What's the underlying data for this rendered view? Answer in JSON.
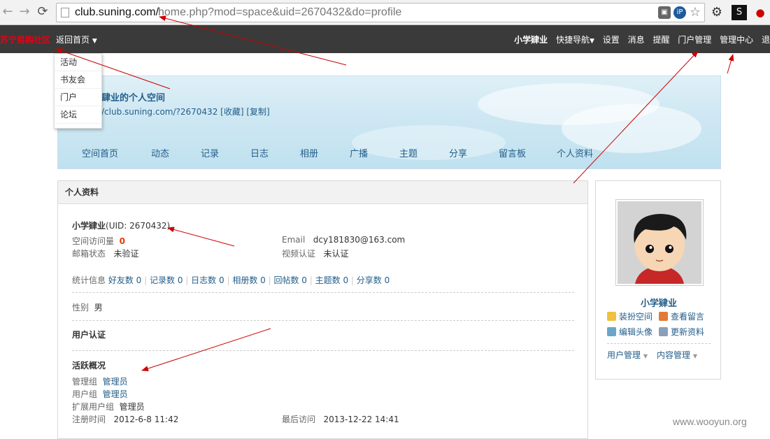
{
  "browser": {
    "url_host": "club.suning.com/",
    "url_path": "home.php?mod=space&uid=2670432&do=profile"
  },
  "topbar": {
    "logo": "苏宁易购社区",
    "home": "返回首页",
    "user": "小学肄业",
    "quicknav": "快捷导航",
    "settings": "设置",
    "messages": "消息",
    "reminders": "提醒",
    "portal_admin": "门户管理",
    "admin_center": "管理中心",
    "logout": "退"
  },
  "dropdown": [
    "活动",
    "书友会",
    "门户",
    "论坛"
  ],
  "banner": {
    "title": "肆业的个人空间",
    "url": "/club.suning.com/?2670432",
    "fav": "[收藏]",
    "copy": "[复制]",
    "nav": [
      "空间首页",
      "动态",
      "记录",
      "日志",
      "相册",
      "广播",
      "主题",
      "分享",
      "留言板",
      "个人资料"
    ]
  },
  "profile": {
    "header": "个人资料",
    "username": "小学肄业",
    "uid": "(UID: 2670432)",
    "visits_label": "空间访问量",
    "visits": "0",
    "email_label": "Email",
    "email": "dcy181830@163.com",
    "mailstatus_label": "邮箱状态",
    "mailstatus": "未验证",
    "video_label": "视频认证",
    "video": "未认证",
    "stats_label": "统计信息",
    "stats": [
      "好友数 0",
      "记录数 0",
      "日志数 0",
      "相册数 0",
      "回帖数 0",
      "主题数 0",
      "分享数 0"
    ],
    "gender_label": "性别",
    "gender": "男",
    "auth_title": "用户认证",
    "activity_title": "活跃概况",
    "admin_group_label": "管理组",
    "admin_group": "管理员",
    "user_group_label": "用户组",
    "user_group": "管理员",
    "ext_group_label": "扩展用户组",
    "ext_group": "管理员",
    "reg_label": "注册时间",
    "reg": "2012-6-8 11:42",
    "last_label": "最后访问",
    "last": "2013-12-22 14:41"
  },
  "card": {
    "name": "小学肄业",
    "decorate": "装扮空间",
    "messages": "查看留言",
    "edit_avatar": "编辑头像",
    "update": "更新资料",
    "user_mgmt": "用户管理",
    "content_mgmt": "内容管理"
  },
  "watermark": "www.wooyun.org",
  "colors": {
    "topbar": "#3a3a3a",
    "link": "#235e8a",
    "logo": "#e60012",
    "arrow": "#cc0000"
  }
}
